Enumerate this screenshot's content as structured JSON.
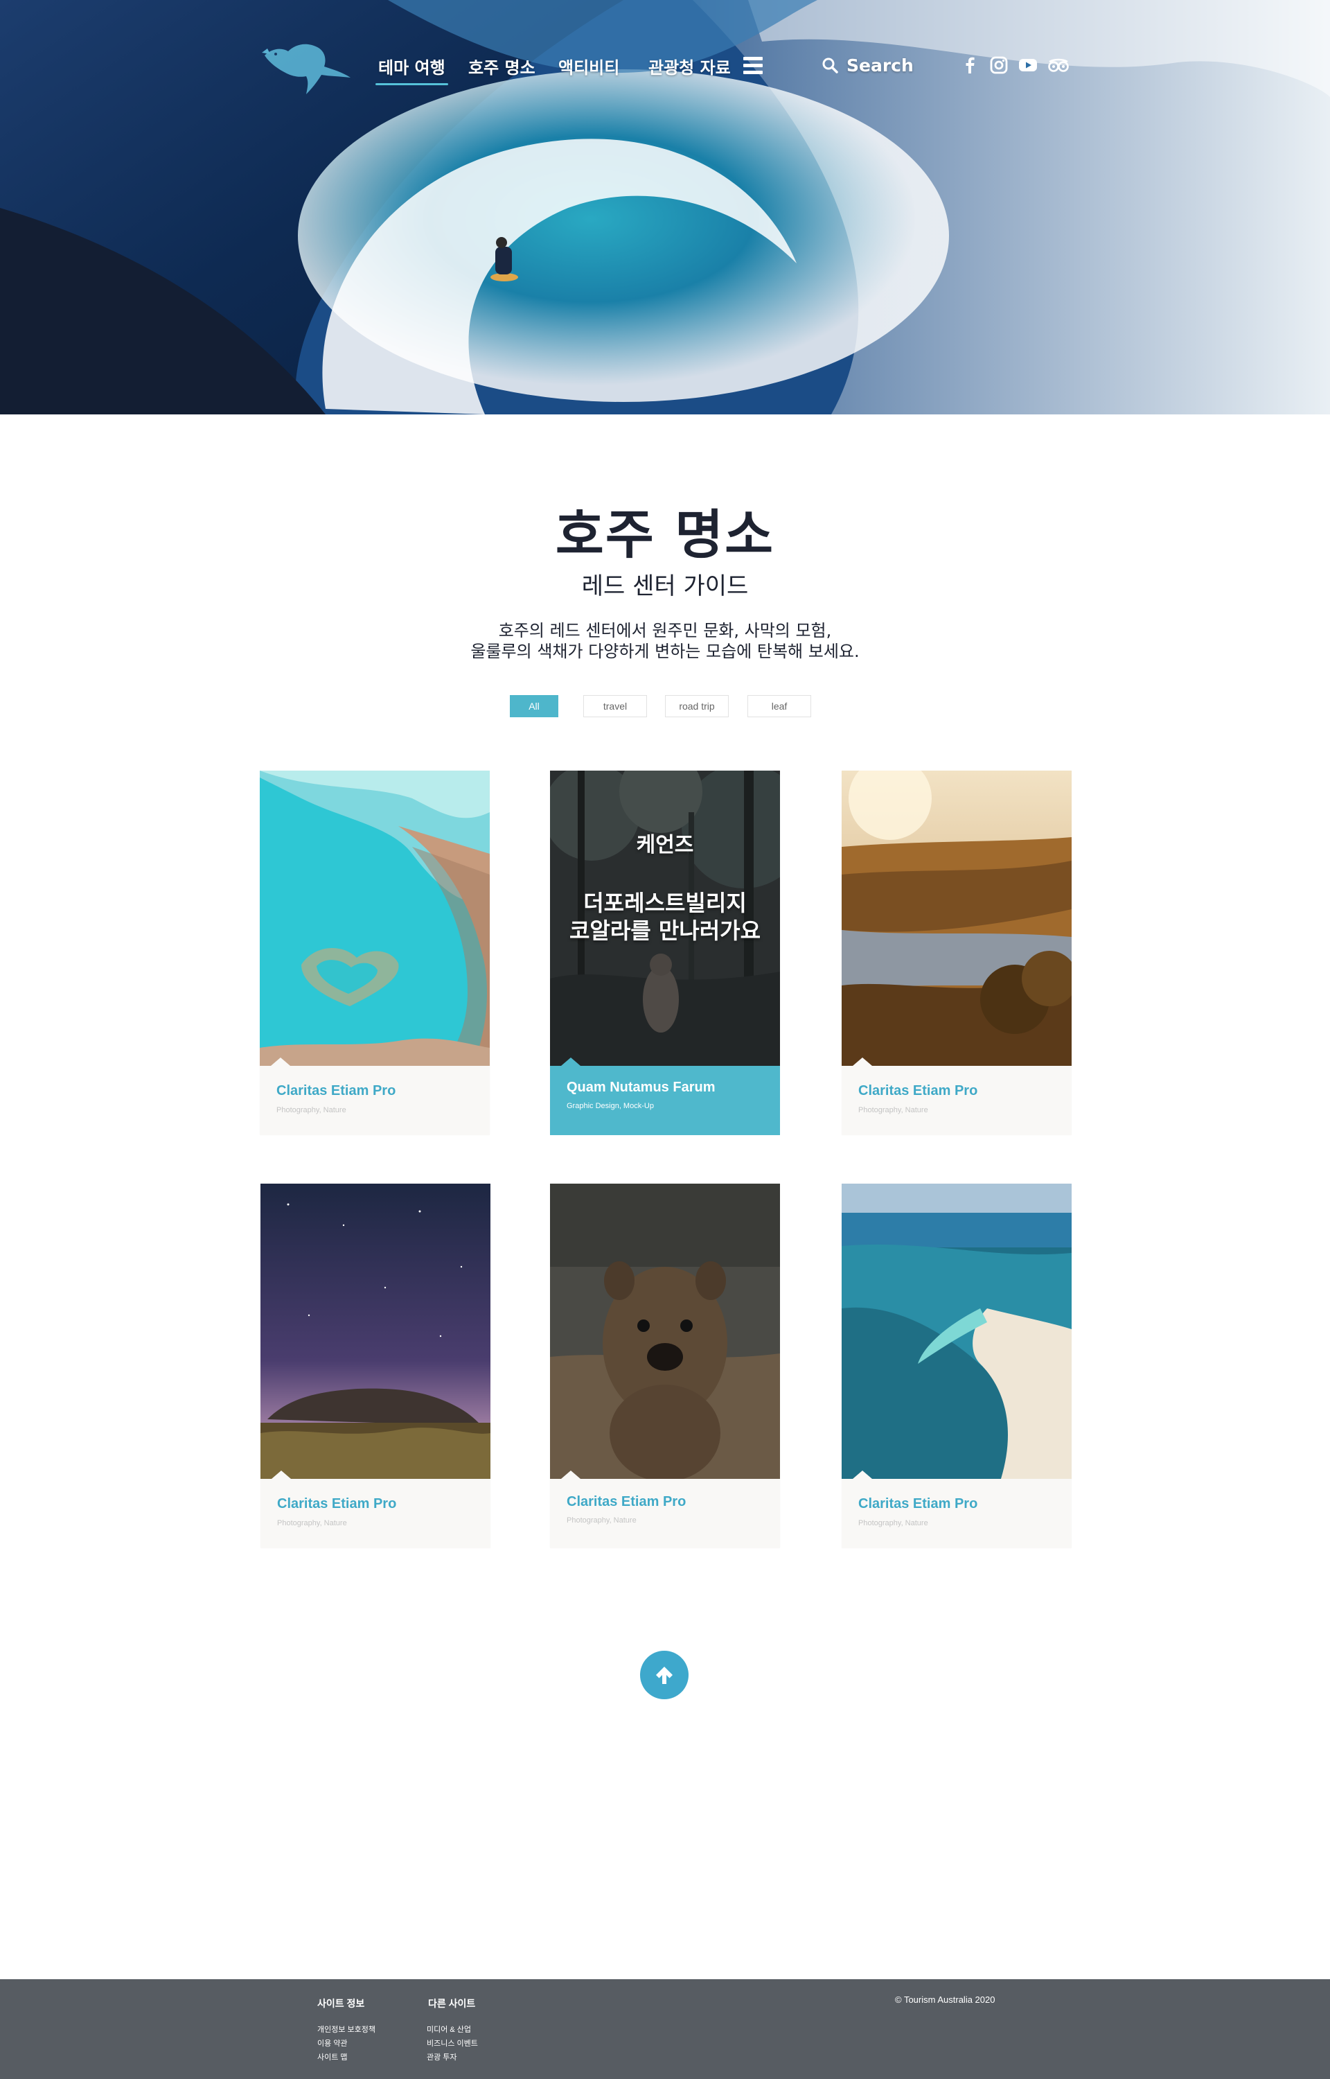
{
  "nav": {
    "items": [
      {
        "label": "테마 여행",
        "active": true
      },
      {
        "label": "호주 명소",
        "active": false
      },
      {
        "label": "액티비티",
        "active": false
      },
      {
        "label": "관광청 자료",
        "active": false
      }
    ],
    "search_label": "Search",
    "social_icons": [
      "facebook-icon",
      "instagram-icon",
      "youtube-icon",
      "tripadvisor-icon"
    ],
    "logo_icon": "kangaroo-logo-icon"
  },
  "intro": {
    "title": "호주 명소",
    "subtitle": "레드 센터 가이드",
    "description_line1": "호주의 레드 센터에서 원주민 문화, 사막의 모험,",
    "description_line2": "울룰루의 색채가 다양하게 변하는 모습에 탄복해 보세요."
  },
  "filters": [
    "All",
    "travel",
    "road trip",
    "leaf"
  ],
  "active_filter": "All",
  "cards": [
    {
      "title": "Claritas Etiam Pro",
      "subtitle": "Photography, Nature",
      "image": "heart-reef"
    },
    {
      "title": "Quam Nutamus Farum",
      "subtitle": "Graphic Design, Mock-Up",
      "image": "forest",
      "featured": true,
      "overlay_line1": "케언즈",
      "overlay_line2": "더포레스트빌리지",
      "overlay_line3": "코알라를 만나러가요"
    },
    {
      "title": "Claritas Etiam Pro",
      "subtitle": "Photography, Nature",
      "image": "river-sunset"
    },
    {
      "title": "Claritas Etiam Pro",
      "subtitle": "Photography, Nature",
      "image": "uluru-night"
    },
    {
      "title": "Claritas Etiam Pro",
      "subtitle": "Photography, Nature",
      "image": "quokka"
    },
    {
      "title": "Claritas Etiam Pro",
      "subtitle": "Photography, Nature",
      "image": "sandbar-beach"
    }
  ],
  "back_to_top_icon": "arrow-up-icon",
  "footer": {
    "col1_heading": "사이트 정보",
    "col1_links": [
      "개인정보 보호정책",
      "이용 약관",
      "사이트 맵"
    ],
    "col2_heading": "다른 사이트",
    "col2_links": [
      "미디어 & 산업",
      "비즈니스 이벤트",
      "관광 투자"
    ],
    "copyright": "© Tourism Australia 2020"
  },
  "colors": {
    "accent": "#4eb6cb",
    "title_blue": "#3fa9c7",
    "footer_bg": "#575c62"
  }
}
